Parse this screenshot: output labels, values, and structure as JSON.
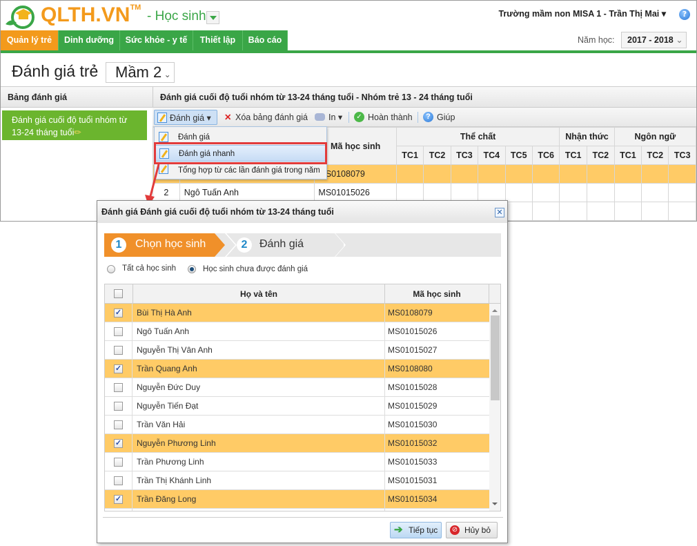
{
  "header": {
    "logo": "QLTH.VN",
    "logo_tm": "TM",
    "role": "- Học sinh",
    "user": "Trường mầm non MISA 1 - Trần Thị Mai"
  },
  "nav": {
    "tabs": [
      "Quản lý trẻ",
      "Dinh dưỡng",
      "Sức khỏe - y tế",
      "Thiết lập",
      "Báo cáo"
    ],
    "active": 0
  },
  "year": {
    "label": "Năm học:",
    "value": "2017 - 2018"
  },
  "page": {
    "title": "Đánh giá trẻ",
    "class_select": "Mầm 2"
  },
  "left_panel": {
    "title": "Bảng đánh giá",
    "items": [
      "Đánh giá cuối độ tuổi nhóm từ 13-24 tháng tuổi"
    ]
  },
  "right_panel": {
    "title": "Đánh giá cuối độ tuổi nhóm từ 13-24 tháng tuổi - Nhóm trẻ 13 - 24 tháng tuổi"
  },
  "toolbar": {
    "evaluate": "Đánh giá",
    "delete": "Xóa bảng đánh giá",
    "print": "In",
    "complete": "Hoàn thành",
    "help": "Giúp"
  },
  "menu": {
    "items": [
      "Đánh giá",
      "Đánh giá nhanh",
      "Tổng hợp từ các lần đánh giá trong năm"
    ],
    "selected": 1
  },
  "grid": {
    "col_code": "Mã học sinh",
    "groups": [
      "Thể chất",
      "Nhận thức",
      "Ngôn ngữ"
    ],
    "sub": [
      "TC1",
      "TC2",
      "TC3",
      "TC4",
      "TC5",
      "TC6",
      "TC1",
      "TC2",
      "TC1",
      "TC2",
      "TC3"
    ],
    "rows": [
      {
        "no": "",
        "name": "",
        "code": "MS0108079"
      },
      {
        "no": "2",
        "name": "Ngô Tuấn Anh",
        "code": "MS01015026"
      }
    ]
  },
  "dialog": {
    "title": "Đánh giá Đánh giá cuối độ tuổi nhóm từ 13-24 tháng tuổi",
    "steps": [
      {
        "num": "1",
        "label": "Chọn học sinh"
      },
      {
        "num": "2",
        "label": "Đánh giá"
      }
    ],
    "radios": [
      {
        "label": "Tất cả học sinh",
        "checked": false
      },
      {
        "label": "Học sinh chưa được đánh giá",
        "checked": true
      }
    ],
    "col_name": "Họ và tên",
    "col_code": "Mã học sinh",
    "students": [
      {
        "name": "Bùi Thị Hà Anh",
        "code": "MS0108079",
        "checked": true
      },
      {
        "name": "Ngô Tuấn Anh",
        "code": "MS01015026",
        "checked": false
      },
      {
        "name": "Nguyễn Thị Vân Anh",
        "code": "MS01015027",
        "checked": false
      },
      {
        "name": "Trần Quang Anh",
        "code": "MS0108080",
        "checked": true
      },
      {
        "name": "Nguyễn Đức Duy",
        "code": "MS01015028",
        "checked": false
      },
      {
        "name": "Nguyễn Tiến Đạt",
        "code": "MS01015029",
        "checked": false
      },
      {
        "name": "Trần Văn Hải",
        "code": "MS01015030",
        "checked": false
      },
      {
        "name": "Nguyễn Phương Linh",
        "code": "MS01015032",
        "checked": true
      },
      {
        "name": "Trần Phương Linh",
        "code": "MS01015033",
        "checked": false
      },
      {
        "name": "Trần Thị Khánh Linh",
        "code": "MS01015031",
        "checked": false
      },
      {
        "name": "Trần Đăng Long",
        "code": "MS01015034",
        "checked": true
      }
    ],
    "continue": "Tiếp tục",
    "cancel": "Hủy bỏ"
  },
  "colors": {
    "orange": "#f39a1c",
    "green": "#3aa647",
    "highlight": "#ffcb66",
    "red": "#e23b3b"
  }
}
